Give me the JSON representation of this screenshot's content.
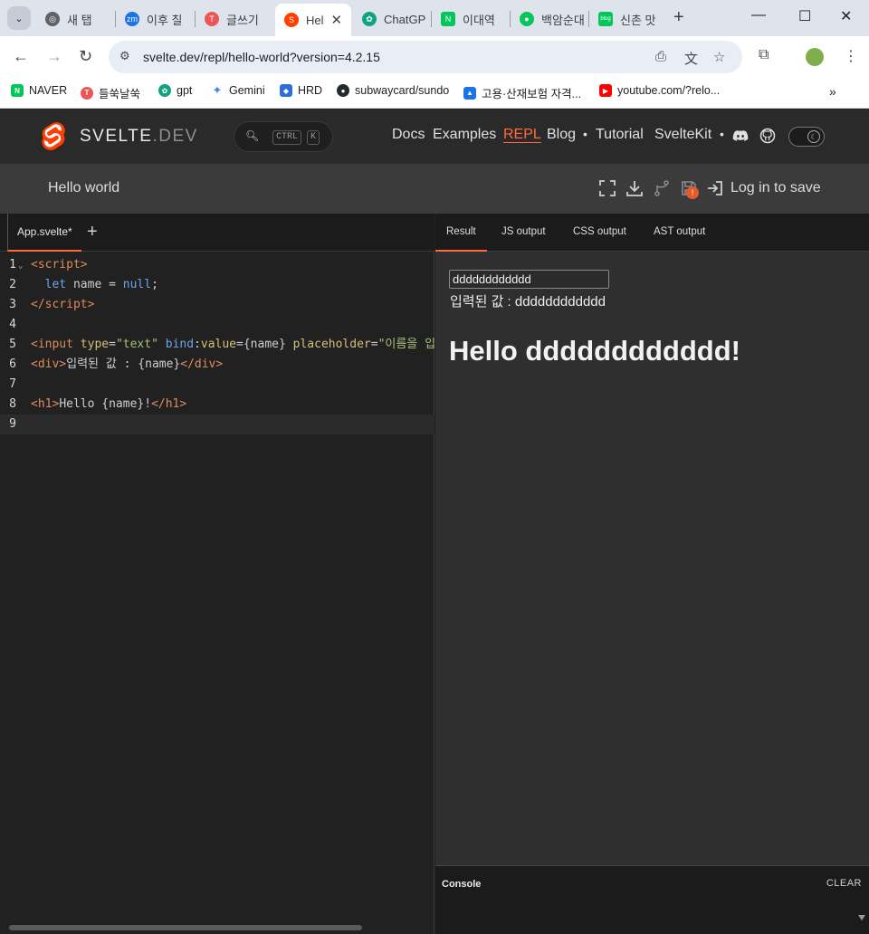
{
  "browser": {
    "tabs": [
      {
        "title": "새 탭",
        "favicon": "chrome-icon",
        "color": "#5f6368"
      },
      {
        "title": "이후 칠",
        "favicon": "zm-icon",
        "color": "#1a73e8"
      },
      {
        "title": "글쓰기",
        "favicon": "tistory-icon",
        "color": "#eb5757"
      },
      {
        "title": "Hel",
        "favicon": "svelte-icon",
        "color": "#ff3e00"
      },
      {
        "title": "ChatGP",
        "favicon": "openai-icon",
        "color": "#10a37f"
      },
      {
        "title": "이대역",
        "favicon": "naver-icon",
        "color": "#03c75a"
      },
      {
        "title": "백암순대",
        "favicon": "map-icon",
        "color": "#03c75a"
      },
      {
        "title": "신촌 맛",
        "favicon": "blog-icon",
        "color": "#03c75a"
      }
    ],
    "url": "svelte.dev/repl/hello-world?version=4.2.15",
    "bookmarks": [
      {
        "label": "NAVER",
        "color": "#03c75a",
        "glyph": "N"
      },
      {
        "label": "들쑥날쑥",
        "color": "#eb5757",
        "glyph": "T"
      },
      {
        "label": "gpt",
        "color": "#10a37f",
        "glyph": "✿"
      },
      {
        "label": "Gemini",
        "color": "#4285f4",
        "glyph": "✦"
      },
      {
        "label": "HRD",
        "color": "#2a6fdb",
        "glyph": "◆"
      },
      {
        "label": "subwaycard/sundo",
        "color": "#24292e",
        "glyph": "●"
      },
      {
        "label": "고용·산재보험 자격...",
        "color": "#1a73e8",
        "glyph": "▲"
      },
      {
        "label": "youtube.com/?relo...",
        "color": "#ff0000",
        "glyph": "▶"
      }
    ]
  },
  "site": {
    "logo_main": "SVELTE",
    "logo_dev": ".DEV",
    "search_keys": [
      "CTRL",
      "K"
    ],
    "nav": [
      "Docs",
      "Examples",
      "REPL",
      "Blog",
      "Tutorial",
      "SvelteKit"
    ],
    "active_nav": "REPL",
    "accent": "#ff6a3d"
  },
  "repl": {
    "title": "Hello world",
    "login_label": "Log in to save",
    "badge": "!",
    "file_tab": "App.svelte*",
    "code_lines": [
      "1",
      "2",
      "3",
      "4",
      "5",
      "6",
      "7",
      "8",
      "9"
    ],
    "output_tabs": [
      "Result",
      "JS output",
      "CSS output",
      "AST output"
    ],
    "preview_input_value": "dddddddddddd",
    "preview_div_text": "입력된 값 : dddddddddddd",
    "preview_h1_text": "Hello dddddddddddd!",
    "console_title": "Console",
    "console_clear": "CLEAR"
  }
}
